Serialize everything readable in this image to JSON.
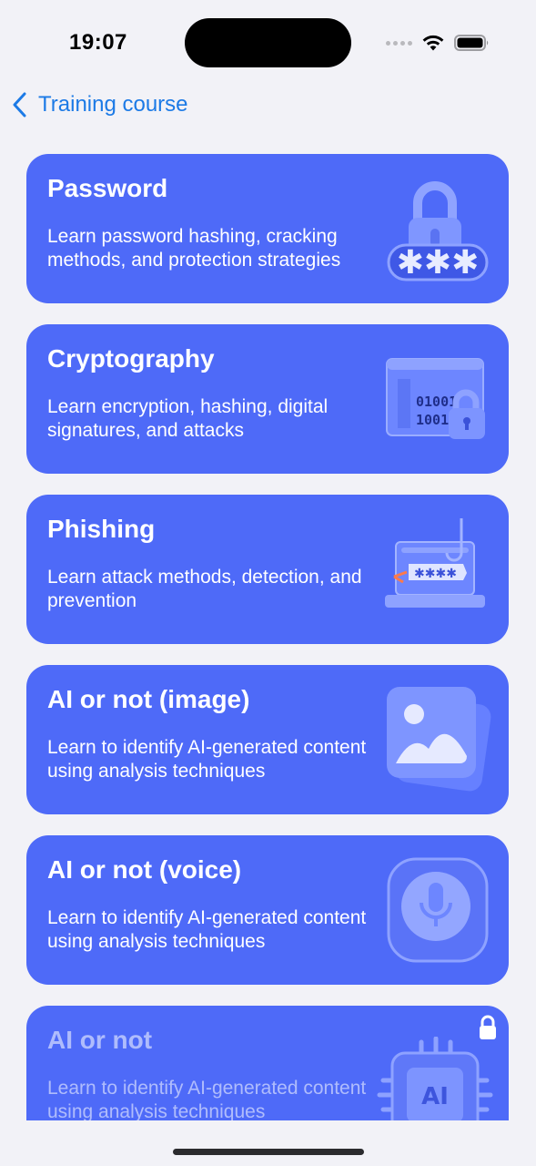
{
  "status_bar": {
    "time": "19:07"
  },
  "nav": {
    "back_label": "Training course"
  },
  "courses": [
    {
      "title": "Password",
      "description": "Learn password hashing, cracking methods, and protection strategies",
      "icon": "password-lock-icon",
      "locked": false
    },
    {
      "title": "Cryptography",
      "description": "Learn encryption, hashing, digital signatures, and attacks",
      "icon": "cryptography-binary-lock-icon",
      "locked": false
    },
    {
      "title": "Phishing",
      "description": "Learn attack methods, detection, and prevention",
      "icon": "phishing-laptop-hook-icon",
      "locked": false
    },
    {
      "title": "AI or not (image)",
      "description": "Learn to identify AI-generated content using analysis techniques",
      "icon": "image-gallery-icon",
      "locked": false
    },
    {
      "title": "AI or not (voice)",
      "description": "Learn to identify AI-generated content using analysis techniques",
      "icon": "microphone-icon",
      "locked": false
    },
    {
      "title": "AI or not",
      "description": "Learn to identify AI-generated content using analysis techniques",
      "icon": "ai-chip-icon",
      "locked": true
    }
  ],
  "colors": {
    "card": "#4e6af8",
    "accent": "#1c7ae6",
    "background": "#f2f2f7"
  }
}
